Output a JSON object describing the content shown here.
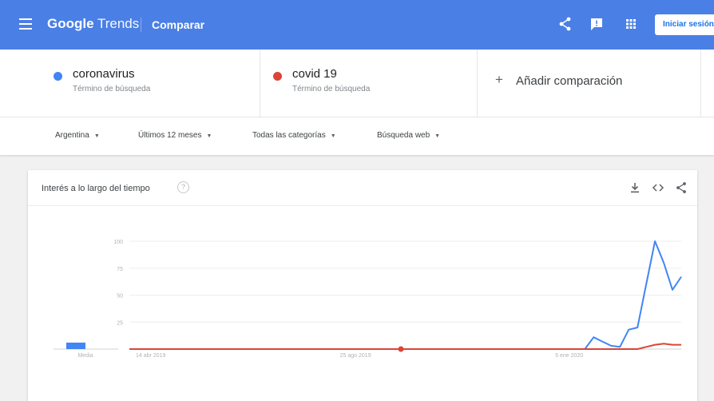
{
  "header": {
    "menu_icon": "menu-icon",
    "logo_google": "Google",
    "logo_trends": "Trends",
    "breadcrumb": "Comparar",
    "share_icon": "share-icon",
    "feedback_icon": "feedback-icon",
    "apps_icon": "apps-grid-icon",
    "signin_label": "Iniciar sesión",
    "background_color": "#4a7fe5"
  },
  "terms": [
    {
      "name": "coronavirus",
      "type": "Término de búsqueda",
      "color": "#4285f4"
    },
    {
      "name": "covid 19",
      "type": "Término de búsqueda",
      "color": "#db4437"
    }
  ],
  "add_comparison": {
    "icon": "plus-icon",
    "label": "Añadir comparación"
  },
  "filters": {
    "region": "Argentina",
    "period": "Últimos 12 meses",
    "category": "Todas las categorías",
    "search_type": "Búsqueda web"
  },
  "card": {
    "title": "Interés a lo largo del tiempo",
    "help_icon": "help-icon",
    "download_icon": "download-icon",
    "embed_icon": "embed-code-icon",
    "share_icon": "share-icon"
  },
  "chart_data": {
    "type": "line",
    "y_ticks": [
      "100",
      "75",
      "50",
      "25"
    ],
    "ylim": [
      0,
      100
    ],
    "average_label": "Media",
    "averages": [
      6,
      0
    ],
    "x_tick_labels": [
      "14 abr 2019",
      "25 ago 2019",
      "5 ene 2020"
    ],
    "grid": true,
    "series": [
      {
        "name": "coronavirus",
        "color": "#4285f4",
        "values": [
          0,
          0,
          0,
          0,
          0,
          0,
          0,
          0,
          0,
          0,
          0,
          0,
          0,
          0,
          0,
          0,
          0,
          0,
          0,
          0,
          0,
          0,
          0,
          0,
          0,
          0,
          0,
          0,
          0,
          0,
          0,
          0,
          0,
          0,
          0,
          0,
          0,
          0,
          0,
          0,
          0,
          0,
          0,
          0,
          0,
          0,
          0,
          0,
          0,
          0,
          0,
          0,
          0,
          11,
          7,
          3,
          2,
          18,
          20,
          60,
          100,
          80,
          55,
          67
        ]
      },
      {
        "name": "covid 19",
        "color": "#db4437",
        "values": [
          0,
          0,
          0,
          0,
          0,
          0,
          0,
          0,
          0,
          0,
          0,
          0,
          0,
          0,
          0,
          0,
          0,
          0,
          0,
          0,
          0,
          0,
          0,
          0,
          0,
          0,
          0,
          0,
          0,
          0,
          0,
          0,
          0,
          0,
          0,
          0,
          0,
          0,
          0,
          0,
          0,
          0,
          0,
          0,
          0,
          0,
          0,
          0,
          0,
          0,
          0,
          0,
          0,
          0,
          0,
          0,
          0,
          0,
          0,
          2,
          4,
          5,
          4,
          4
        ]
      }
    ],
    "annotation_marker_index": 31
  }
}
